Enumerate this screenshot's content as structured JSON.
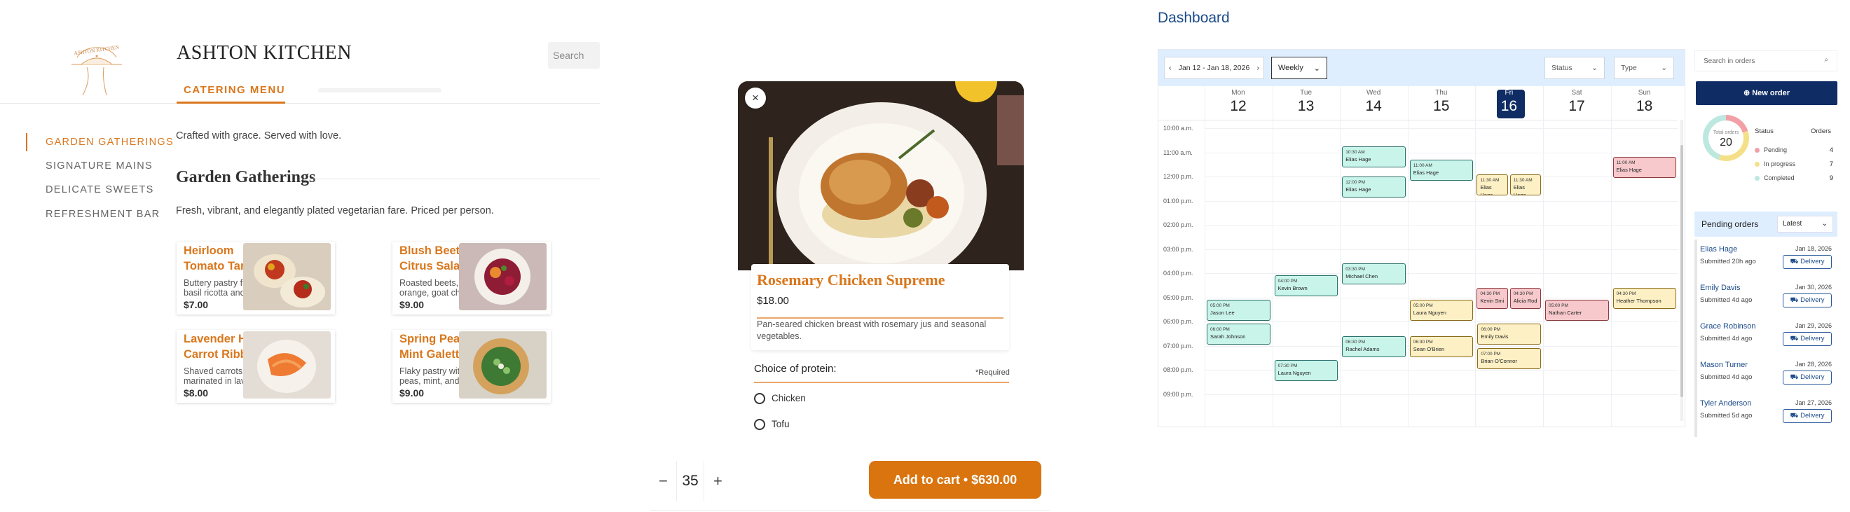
{
  "site": {
    "brand": "ASHTON KITCHEN",
    "logo_text": "ASHTON KITCHEN",
    "search_placeholder": "Search",
    "active_tab": "CATERING MENU",
    "sidebar": [
      {
        "label": "GARDEN GATHERINGS",
        "active": true
      },
      {
        "label": "SIGNATURE MAINS",
        "active": false
      },
      {
        "label": "DELICATE SWEETS",
        "active": false
      },
      {
        "label": "REFRESHMENT BAR",
        "active": false
      }
    ],
    "tagline": "Crafted with grace. Served with love.",
    "section_title": "Garden Gatherings",
    "section_sub": "Fresh, vibrant, and elegantly plated vegetarian fare. Priced per person.",
    "cards": [
      {
        "name": "Heirloom Tomato Tartlet",
        "desc": "Buttery pastry filled with basil ricotta and sweet...",
        "price": "$7.00"
      },
      {
        "name": "Blush Beet & Citrus Salad",
        "desc": "Roasted beets, blood orange, goat cheese...",
        "price": "$9.00"
      },
      {
        "name": "Lavender Honey Carrot Ribbons",
        "desc": "Shaved carrots marinated in lavender...",
        "price": "$8.00"
      },
      {
        "name": "Spring Pea & Mint Galette",
        "desc": "Flaky pastry with sweet peas, mint, and lemon...",
        "price": "$9.00"
      }
    ]
  },
  "modal": {
    "close_icon": "×",
    "name": "Rosemary Chicken Supreme",
    "price": "$18.00",
    "desc": "Pan-seared chicken breast with rosemary jus and seasonal vegetables.",
    "choice_title": "Choice of protein:",
    "required": "*Required",
    "options": [
      "Chicken",
      "Tofu"
    ],
    "qty_minus": "−",
    "qty": "35",
    "qty_plus": "+",
    "cart_label": "Add to cart • $630.00"
  },
  "dashboard": {
    "title": "Dashboard",
    "date_range": "Jan 12 - Jan 18, 2026",
    "view": "Weekly",
    "status_filter": "Status",
    "type_filter": "Type",
    "days": [
      {
        "name": "Mon",
        "date": "12"
      },
      {
        "name": "Tue",
        "date": "13"
      },
      {
        "name": "Wed",
        "date": "14"
      },
      {
        "name": "Thu",
        "date": "15"
      },
      {
        "name": "Fri",
        "date": "16",
        "today": true
      },
      {
        "name": "Sat",
        "date": "17"
      },
      {
        "name": "Sun",
        "date": "18"
      }
    ],
    "times": [
      "10:00 a.m.",
      "11:00 a.m.",
      "12:00 p.m.",
      "01:00 p.m.",
      "02:00 p.m.",
      "03:00 p.m.",
      "04:00 p.m.",
      "05:00 p.m.",
      "06:00 p.m.",
      "07:00 p.m.",
      "08:00 p.m.",
      "09:00 p.m."
    ],
    "events": [
      {
        "day": 2,
        "start": 10.75,
        "time": "10:30 AM",
        "name": "Elias Hage",
        "color": "green"
      },
      {
        "day": 2,
        "start": 12.0,
        "time": "12:00 PM",
        "name": "Elias Hage",
        "color": "green"
      },
      {
        "day": 3,
        "start": 11.3,
        "time": "11:00 AM",
        "name": "Elias Hage",
        "color": "green"
      },
      {
        "day": 4,
        "start": 11.9,
        "time": "11:30 AM",
        "name": "Elias Hage",
        "color": "yellow",
        "half": 0
      },
      {
        "day": 4,
        "start": 11.9,
        "time": "11:30 AM",
        "name": "Elias Hage",
        "color": "yellow",
        "half": 1
      },
      {
        "day": 6,
        "start": 11.2,
        "time": "11:00 AM",
        "name": "Elias Hage",
        "color": "red"
      },
      {
        "day": 2,
        "start": 15.6,
        "time": "03:30 PM",
        "name": "Michael Chen",
        "color": "green"
      },
      {
        "day": 1,
        "start": 16.1,
        "time": "04:00 PM",
        "name": "Kevin Brown",
        "color": "green"
      },
      {
        "day": 0,
        "start": 17.1,
        "time": "05:00 PM",
        "name": "Jason Lee",
        "color": "green"
      },
      {
        "day": 0,
        "start": 18.1,
        "time": "06:00 PM",
        "name": "Sarah Johnson",
        "color": "green"
      },
      {
        "day": 3,
        "start": 17.1,
        "time": "05:00 PM",
        "name": "Laura Nguyen",
        "color": "yellow"
      },
      {
        "day": 4,
        "start": 16.6,
        "time": "04:30 PM",
        "name": "Kevin Smi",
        "color": "red",
        "half": 0
      },
      {
        "day": 4,
        "start": 16.6,
        "time": "04:30 PM",
        "name": "Alicia Rod",
        "color": "red",
        "half": 1
      },
      {
        "day": 5,
        "start": 17.1,
        "time": "05:00 PM",
        "name": "Nathan Carter",
        "color": "red"
      },
      {
        "day": 6,
        "start": 16.6,
        "time": "04:30 PM",
        "name": "Heather Thompson",
        "color": "yellow"
      },
      {
        "day": 4,
        "start": 18.1,
        "time": "06:00 PM",
        "name": "Emily Davis",
        "color": "yellow"
      },
      {
        "day": 2,
        "start": 18.6,
        "time": "06:30 PM",
        "name": "Rachel Adams",
        "color": "green"
      },
      {
        "day": 3,
        "start": 18.6,
        "time": "06:30 PM",
        "name": "Sean O'Brien",
        "color": "yellow"
      },
      {
        "day": 4,
        "start": 19.1,
        "time": "07:00 PM",
        "name": "Brian O'Connor",
        "color": "yellow"
      },
      {
        "day": 1,
        "start": 19.6,
        "time": "07:30 PM",
        "name": "Laura Nguyen",
        "color": "green"
      }
    ],
    "search_placeholder": "Search in orders",
    "new_order": "New order",
    "total_label": "Total orders",
    "total": "20",
    "status_header": "Status",
    "orders_header": "Orders",
    "stats": [
      {
        "label": "Pending",
        "count": "4",
        "color": "#f2a0a6"
      },
      {
        "label": "In progress",
        "count": "7",
        "color": "#f5e08a"
      },
      {
        "label": "Completed",
        "count": "9",
        "color": "#bde8e0"
      }
    ],
    "pending_title": "Pending orders",
    "pending_sort": "Latest",
    "pending": [
      {
        "name": "Elias Hage",
        "date": "Jan 18, 2026",
        "sub": "Submitted 20h ago",
        "type": "Delivery"
      },
      {
        "name": "Emily Davis",
        "date": "Jan 30, 2026",
        "sub": "Submitted 4d ago",
        "type": "Delivery"
      },
      {
        "name": "Grace Robinson",
        "date": "Jan 29, 2026",
        "sub": "Submitted 4d ago",
        "type": "Delivery"
      },
      {
        "name": "Mason Turner",
        "date": "Jan 28, 2026",
        "sub": "Submitted 4d ago",
        "type": "Delivery"
      },
      {
        "name": "Tyler Anderson",
        "date": "Jan 27, 2026",
        "sub": "Submitted 5d ago",
        "type": "Delivery"
      }
    ]
  }
}
